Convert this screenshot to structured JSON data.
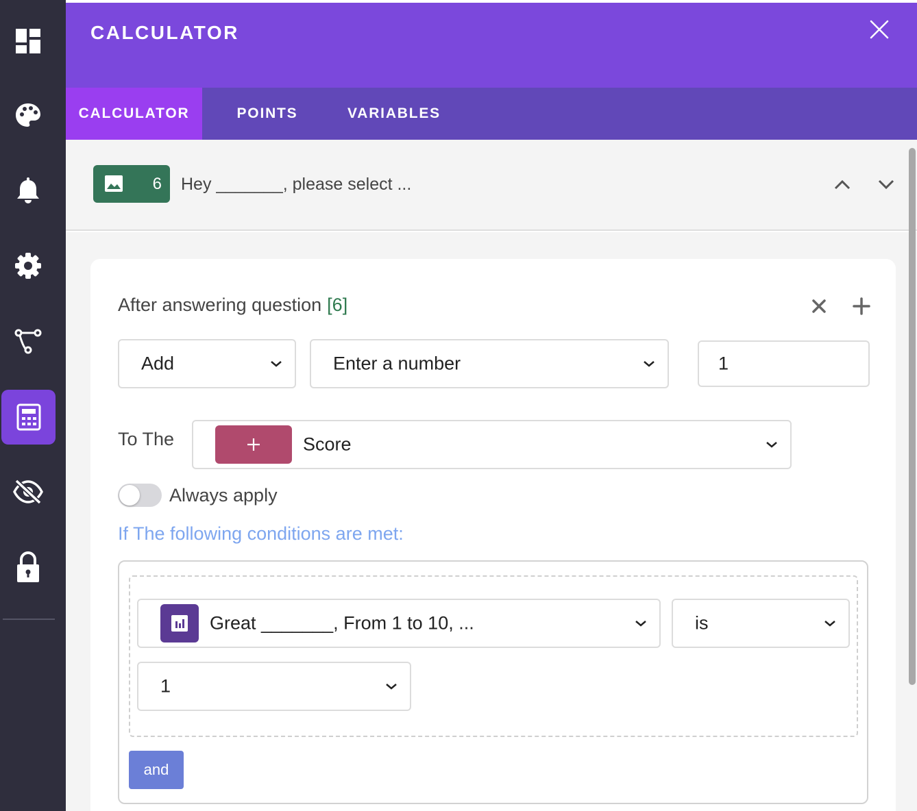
{
  "sidebar": {
    "items": [
      {
        "icon": "dashboard-icon"
      },
      {
        "icon": "palette-icon"
      },
      {
        "icon": "bell-icon"
      },
      {
        "icon": "gear-icon"
      },
      {
        "icon": "logic-flow-icon"
      },
      {
        "icon": "calculator-icon",
        "active": true
      },
      {
        "icon": "eye-off-icon"
      },
      {
        "icon": "lock-icon"
      }
    ]
  },
  "header": {
    "title": "CALCULATOR"
  },
  "tabs": [
    {
      "label": "CALCULATOR",
      "active": true
    },
    {
      "label": "POINTS"
    },
    {
      "label": "VARIABLES"
    }
  ],
  "question": {
    "number": "6",
    "text": "Hey _______, please select ..."
  },
  "rule": {
    "heading": "After answering question",
    "question_ref": "[6]",
    "operation": "Add",
    "value_type": "Enter a number",
    "value": "1",
    "to_the_label": "To The",
    "target": "Score",
    "target_chip_symbol": "+",
    "always_apply_label": "Always apply",
    "always_apply_on": false,
    "conditions_title": "If The following conditions are met:",
    "condition": {
      "question": "Great _______, From 1 to 10, ...",
      "operator": "is",
      "answer": "1"
    },
    "and_label": "and"
  },
  "colors": {
    "header": "#7b48dc",
    "tabs": "#6148b8",
    "active_tab": "#9a3ef0",
    "sidebar": "#2f2e3d",
    "question_badge": "#347558",
    "score_chip": "#b04a6d",
    "chart_chip": "#5b3a94",
    "and_button": "#6b7fd7",
    "conditions_title": "#7ea6ef"
  }
}
